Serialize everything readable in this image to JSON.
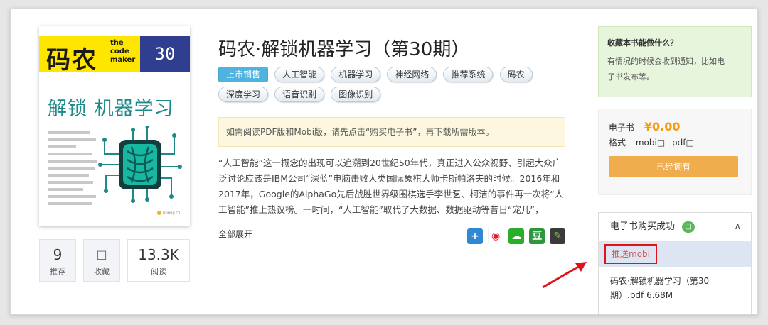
{
  "cover": {
    "brand": "码农",
    "sub": [
      "the",
      "code",
      "maker"
    ],
    "issue": "30",
    "title": "解锁 机器学习",
    "publisher": "iTuring.cn",
    "colors": {
      "yellow": "#ffe600",
      "navy": "#2f3e8f",
      "teal": "#1c8a86"
    }
  },
  "stats": [
    {
      "value": "9",
      "label": "推荐"
    },
    {
      "value": "□",
      "label": "收藏"
    },
    {
      "value": "13.3K",
      "label": "阅读"
    }
  ],
  "book": {
    "title": "码农·解锁机器学习（第30期）",
    "sale_tag": "上市销售",
    "tags": [
      "人工智能",
      "机器学习",
      "神经网络",
      "推荐系统",
      "码农",
      "深度学习",
      "语音识别",
      "图像识别"
    ],
    "notice": "如需阅读PDF版和Mobi版，请先点击“购买电子书”，再下载所需版本。",
    "description": [
      "“人工智能”这一概念的出现可以追溯到20世纪50年代，真正进入公众视野、引起大众广",
      "泛讨论应该是IBM公司“深蓝”电脑击败人类国际象棋大师卡斯帕洛夫的时候。2016年和",
      "2017年，Google的AlphaGo先后战胜世界级围棋选手李世乭、柯洁的事件再一次将“人",
      "工智能”推上热议榜。一时间，“人工智能”取代了大数据、数据驱动等昔日“宠儿”，"
    ],
    "expand": "全部展开"
  },
  "share_icons": [
    "plus-share-icon",
    "weibo-icon",
    "wechat-icon",
    "douban-icon",
    "evernote-icon"
  ],
  "hint": {
    "title": "收藏本书能做什么？",
    "body": [
      "有情况的时候会收到通知，比如电",
      "子书发布等。"
    ]
  },
  "buy": {
    "ebook_label": "电子书",
    "price": "¥0.00",
    "format_label": "格式",
    "formats": [
      "mobi□",
      "pdf□"
    ],
    "owned_button": "已经拥有",
    "accent": "#f0ad4e"
  },
  "download": {
    "header": "电子书购买成功",
    "badge": "□",
    "push_button": "推送mobi",
    "file_lines": [
      "码农·解锁机器学习（第30",
      "期）.pdf 6.68M"
    ]
  }
}
